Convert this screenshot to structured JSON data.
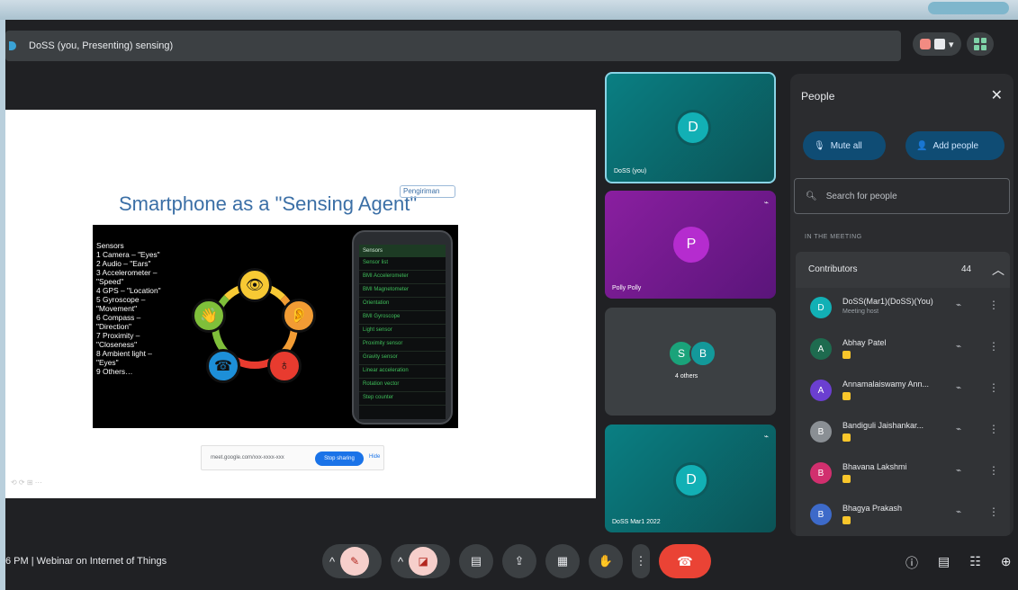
{
  "window": {
    "title": "DoSS (you, Presenting) sensing)",
    "top_actions": [
      "▾"
    ]
  },
  "slide": {
    "title": "Smartphone as a \"Sensing Agent\"",
    "badge": "Pengiriman",
    "sensors": [
      "Sensors",
      "1 Camera – \"Eyes\"",
      "2 Audio – \"Ears\"",
      "3 Accelerometer –",
      "   \"Speed\"",
      "4 GPS – \"Location\"",
      "5 Gyroscope –",
      "   \"Movement\"",
      "6 Compass –",
      "   \"Direction\"",
      "7 Proximity –",
      "   \"Closeness\"",
      "8 Ambient light –",
      "   \"Eyes\"",
      "9 Others…"
    ],
    "wheel_icons": [
      "👁",
      "👂",
      "👋",
      "☎",
      "♁"
    ],
    "phone_title": "Sensors",
    "phone_rows": [
      "Sensor list",
      "BMI Accelerometer",
      "BMI Magnetometer",
      "Orientation",
      "BMI Gyroscope",
      "Light sensor",
      "Proximity sensor",
      "Gravity sensor",
      "Linear acceleration",
      "Rotation vector",
      "Step counter"
    ],
    "link_text": "meet.google.com/xxx-xxxx-xxx",
    "link_button": "Stop sharing",
    "link_other": "Hide",
    "footer": "⟲ ⟳ ⊞ ⋯"
  },
  "tiles": [
    {
      "initial": "D",
      "name": "DoSS (you)",
      "mic": ""
    },
    {
      "initial": "P",
      "name": "Polly Polly",
      "mic": "⌁"
    },
    {
      "initials": [
        "S",
        "B"
      ],
      "name": "4 others",
      "mic": ""
    },
    {
      "initial": "D",
      "name": "DoSS Mar1 2022",
      "mic": "⌁"
    }
  ],
  "panel": {
    "title": "People",
    "close": "✕",
    "mute_all": "Mute all",
    "add_people": "Add people",
    "search_placeholder": "Search for people",
    "section": "IN THE MEETING",
    "group_label": "Contributors",
    "group_count": "44",
    "group_chevron": "︿",
    "participants": [
      {
        "initial": "D",
        "name": "DoSS(Mar1)(DoSS)(You)",
        "sub": "Meeting host",
        "color": "#12b0b5",
        "badge": false
      },
      {
        "initial": "A",
        "name": "Abhay Patel",
        "sub": "",
        "color": "#1e6b4f",
        "badge": true
      },
      {
        "initial": "A",
        "name": "Annamalaiswamy Ann...",
        "sub": "",
        "color": "#6b3fd1",
        "badge": true
      },
      {
        "initial": "B",
        "name": "Bandiguli Jaishankar...",
        "sub": "",
        "color": "#8a8f94",
        "badge": true
      },
      {
        "initial": "B",
        "name": "Bhavana Lakshmi",
        "sub": "",
        "color": "#d12f6e",
        "badge": true
      },
      {
        "initial": "B",
        "name": "Bhagya Prakash",
        "sub": "",
        "color": "#3d6ac9",
        "badge": true
      }
    ],
    "mic_icon": "⌁",
    "more_icon": "⋮"
  },
  "bottom": {
    "meeting_info": "6 PM  |  Webinar on Internet of Things",
    "controls": {
      "mic_caret": "^",
      "mic_icon": "✎",
      "cam_caret": "^",
      "cam_icon": "◪",
      "captions_icon": "▤",
      "present_icon": "⇪",
      "layout_icon": "▦",
      "hand_icon": "✋",
      "more_icon": "⋮",
      "end_icon": "☎"
    },
    "right_icons": [
      "ⓘ",
      "▤",
      "☷",
      "⊕"
    ]
  }
}
